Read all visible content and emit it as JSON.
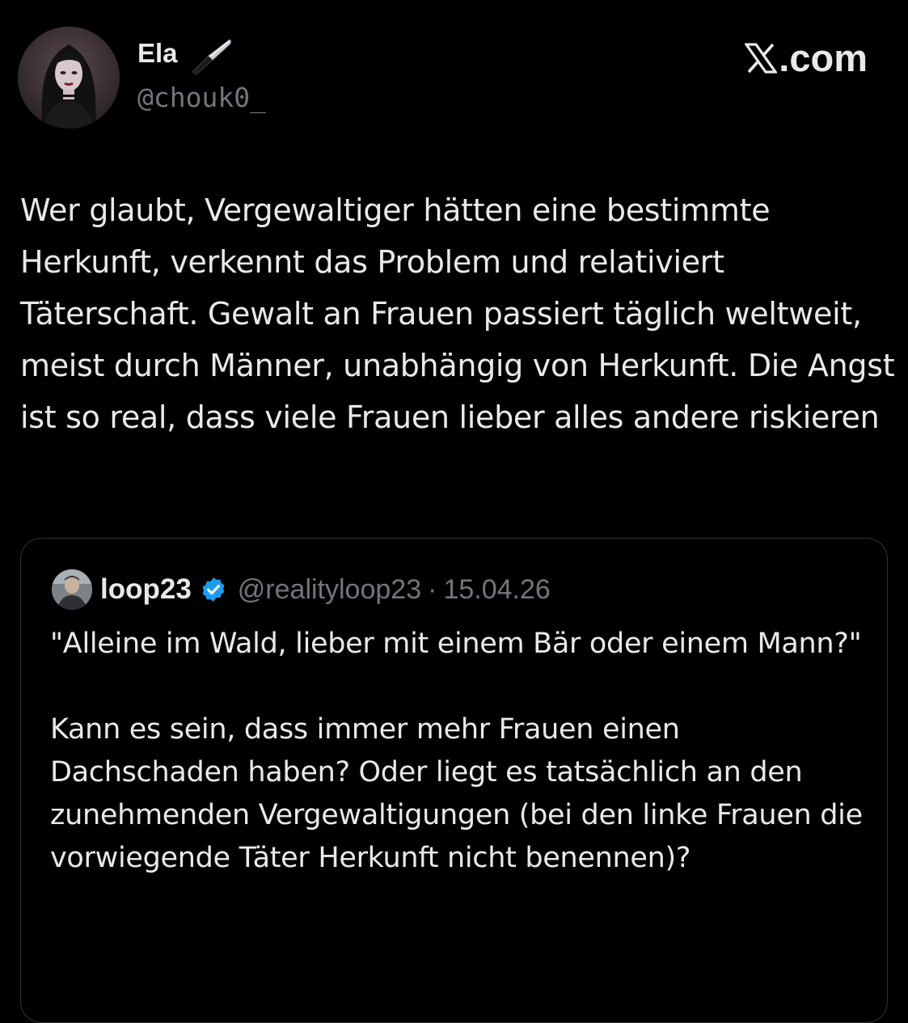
{
  "author": {
    "name": "Ela",
    "name_emoji": "knife-icon",
    "handle": "@chouk0_",
    "avatar": "avatar-woman-dark-hair"
  },
  "site_label": ".com",
  "site_logo_icon": "x-logo-icon",
  "tweet_text": "Wer glaubt, Vergewaltiger hätten eine bestimmte Herkunft, verkennt das Problem und relativiert Täterschaft. Gewalt an Frauen passiert täglich weltweit, meist durch Männer, unabhängig von Herkunft. Die Angst ist so real, dass viele Frauen lieber alles andere riskieren",
  "quote": {
    "name": "loop23",
    "verified": true,
    "verified_color": "#1d9bf0",
    "handle": "@realityloop23",
    "separator": "·",
    "date": "15.04.26",
    "text": "\"Alleine im Wald, lieber mit einem Bär oder einem Mann?\"\n\nKann es sein, dass immer mehr Frauen einen Dachschaden haben? Oder liegt es tatsächlich an den zunehmenden Vergewaltigungen (bei den linke Frauen die vorwiegende Täter Herkunft nicht benennen)?"
  },
  "colors": {
    "background": "#000000",
    "text_primary": "#e7e9ea",
    "text_secondary": "#71767b",
    "border": "#2f3336"
  }
}
